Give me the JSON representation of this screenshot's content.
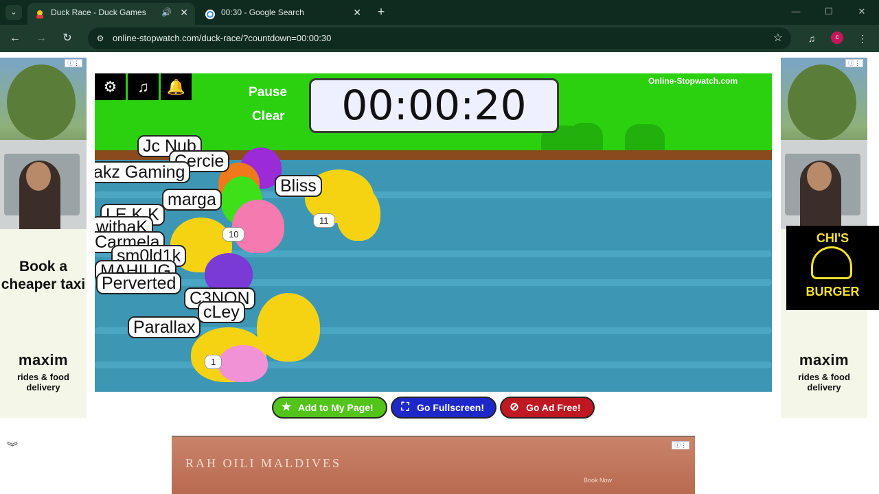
{
  "browser": {
    "tabs": [
      {
        "title": "Duck Race - Duck Games",
        "active": true,
        "audio": true
      },
      {
        "title": "00:30 - Google Search",
        "active": false,
        "audio": false
      }
    ],
    "url": "online-stopwatch.com/duck-race/?countdown=00:00:30",
    "profile_initial": "c"
  },
  "game": {
    "links": {
      "pause": "Pause",
      "clear": "Clear"
    },
    "timer": "00:00:20",
    "brand": "Online-Stopwatch.com",
    "name_tags": [
      "Jc Nub",
      "Cercie",
      "akz Gaming",
      "Bliss",
      "marga",
      "LE.K.K",
      "withaK",
      "Carmela",
      "sm0ld1k",
      "MAHILIG",
      "Perverted",
      "C3NON",
      "cLey",
      "Parallax"
    ],
    "number_tags": [
      "11",
      "10",
      "1"
    ]
  },
  "actions": {
    "add": "Add to My Page!",
    "fullscreen": "Go Fullscreen!",
    "adfree": "Go Ad Free!"
  },
  "ads": {
    "left": {
      "headline": "Book a cheaper taxi",
      "brand": "maxim",
      "tag": "rides & food delivery"
    },
    "right": {
      "brand": "maxim",
      "tag": "rides & food delivery",
      "logo_top": "CHI'S",
      "logo_bottom": "BURGER"
    },
    "bottom": {
      "hotel": "RAH OILI MALDIVES",
      "cta": "Book Now"
    }
  },
  "colors": {
    "chrome_dark": "#0f2a1e",
    "chrome_toolbar": "#1e3d2f",
    "game_green": "#27c90d",
    "water": "#3d96b3",
    "add_btn": "#53c41a",
    "fullscreen_btn": "#1e28c8",
    "adfree_btn": "#c01822"
  }
}
